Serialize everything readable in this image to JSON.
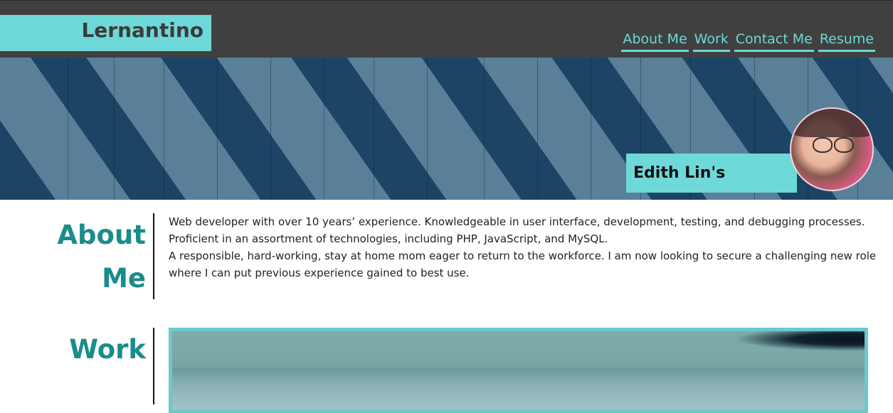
{
  "header": {
    "logo": "Lernantino",
    "nav": [
      {
        "label": "About Me"
      },
      {
        "label": "Work"
      },
      {
        "label": "Contact Me"
      },
      {
        "label": "Resume"
      }
    ]
  },
  "hero": {
    "title": "Edith Lin's Portfolio"
  },
  "about": {
    "heading_line1": "About",
    "heading_line2": "Me",
    "paragraph1": "Web developer with over 10 years’ experience. Knowledgeable in user interface, development, testing, and debugging processes. Proficient in an assortment of technologies, including PHP, JavaScript, and MySQL.",
    "paragraph2": "A responsible, hard-working, stay at home mom eager to return to the workforce. I am now looking to secure a challenging new role where I can put previous experience gained to best use."
  },
  "work": {
    "heading": "Work"
  },
  "colors": {
    "accent": "#6fd8d8",
    "heading": "#1a8c8c",
    "header_bg": "#404040"
  }
}
